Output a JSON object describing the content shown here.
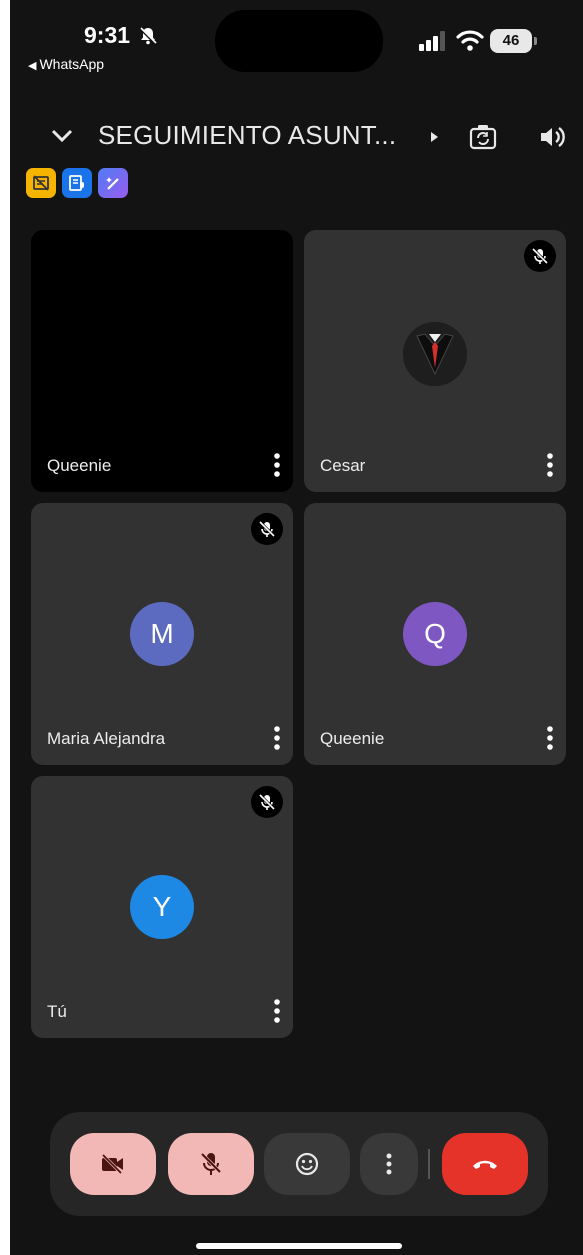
{
  "status_bar": {
    "time": "9:31",
    "back_app": "WhatsApp",
    "battery": "46"
  },
  "header": {
    "title": "SEGUIMIENTO ASUNT..."
  },
  "participants": [
    {
      "name": "Queenie",
      "avatar": "",
      "muted": false,
      "video": "black"
    },
    {
      "name": "Cesar",
      "avatar": "suit-logo",
      "muted": true
    },
    {
      "name": "Maria Alejandra",
      "avatar": "M",
      "avatar_color": "#5c6bc0",
      "muted": true
    },
    {
      "name": "Queenie",
      "avatar": "Q",
      "avatar_color": "#7e57c2",
      "muted": false
    },
    {
      "name": "Tú",
      "avatar": "Y",
      "avatar_color": "#1e88e5",
      "muted": true
    }
  ],
  "controls": {
    "camera": "camera-off-icon",
    "mic": "mic-off-icon",
    "reactions": "emoji-icon",
    "more": "more-vert-icon",
    "end_call": "hang-up-icon",
    "end_call_color": "#e5332a"
  }
}
